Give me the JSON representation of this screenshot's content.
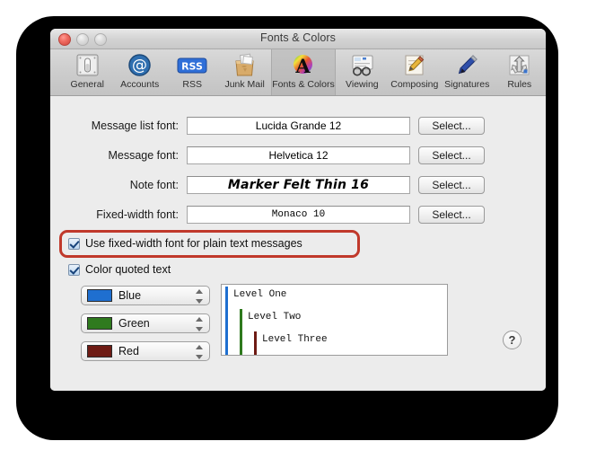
{
  "window": {
    "title": "Fonts & Colors",
    "traffic_lights": {
      "close": "close-button",
      "minimize": "minimize-button",
      "zoom": "zoom-button"
    }
  },
  "toolbar": {
    "items": [
      {
        "label": "General",
        "icon": "general-switch-icon",
        "selected": false
      },
      {
        "label": "Accounts",
        "icon": "at-sign-icon",
        "selected": false
      },
      {
        "label": "RSS",
        "icon": "rss-badge-icon",
        "selected": false
      },
      {
        "label": "Junk Mail",
        "icon": "junk-mail-bag-icon",
        "selected": false
      },
      {
        "label": "Fonts & Colors",
        "icon": "color-wheel-a-icon",
        "selected": true
      },
      {
        "label": "Viewing",
        "icon": "eyeglasses-icon",
        "selected": false
      },
      {
        "label": "Composing",
        "icon": "pencil-paper-icon",
        "selected": false
      },
      {
        "label": "Signatures",
        "icon": "fountain-pen-icon",
        "selected": false
      },
      {
        "label": "Rules",
        "icon": "funnel-arrows-icon",
        "selected": false
      }
    ]
  },
  "form": {
    "rows": [
      {
        "label": "Message list font:",
        "value": "Lucida Grande 12",
        "button": "Select...",
        "style": "sans"
      },
      {
        "label": "Message font:",
        "value": "Helvetica 12",
        "button": "Select...",
        "style": "sans"
      },
      {
        "label": "Note font:",
        "value": "Marker Felt Thin 16",
        "button": "Select...",
        "style": "marker"
      },
      {
        "label": "Fixed-width font:",
        "value": "Monaco 10",
        "button": "Select...",
        "style": "mono"
      }
    ]
  },
  "checkboxes": [
    {
      "label": "Use fixed-width font for plain text messages",
      "checked": true,
      "highlighted": true
    },
    {
      "label": "Color quoted text",
      "checked": true,
      "highlighted": false
    }
  ],
  "quote_colors": [
    {
      "label": "Blue",
      "color": "#1f6fd0"
    },
    {
      "label": "Green",
      "color": "#2f7a1e"
    },
    {
      "label": "Red",
      "color": "#6e1b14"
    }
  ],
  "preview": {
    "lines": [
      {
        "text": "Level One",
        "indent": 0
      },
      {
        "text": "Level Two",
        "indent": 1
      },
      {
        "text": "Level Three",
        "indent": 2
      }
    ]
  },
  "help": {
    "label": "?"
  }
}
